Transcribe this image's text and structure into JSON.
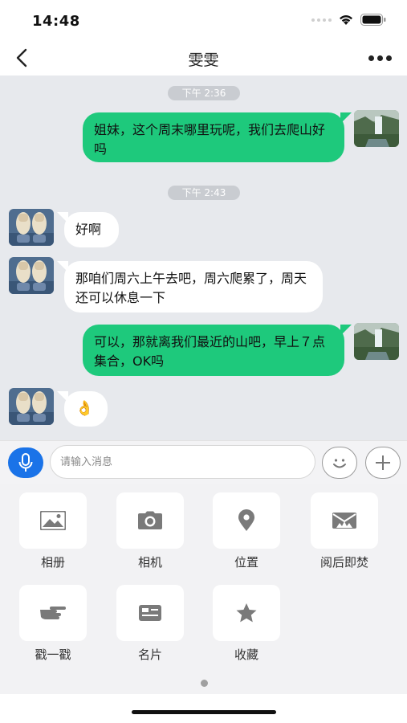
{
  "status": {
    "time": "14:48"
  },
  "nav": {
    "title": "雯雯"
  },
  "chat": {
    "time1": "下午 2:36",
    "msg1": "姐妹，这个周末哪里玩呢，我们去爬山好吗",
    "time2": "下午 2:43",
    "msg2": "好啊",
    "msg3": "那咱们周六上午去吧，周六爬累了，周天还可以休息一下",
    "msg4": "可以，那就离我们最近的山吧，早上７点集合，OK吗",
    "msg5": "👌"
  },
  "input": {
    "placeholder": "请输入消息"
  },
  "panel": {
    "items": [
      {
        "label": "相册",
        "icon": "image-icon"
      },
      {
        "label": "相机",
        "icon": "camera-icon"
      },
      {
        "label": "位置",
        "icon": "location-icon"
      },
      {
        "label": "阅后即焚",
        "icon": "burn-after-reading-icon"
      },
      {
        "label": "戳一戳",
        "icon": "poke-hand-icon"
      },
      {
        "label": "名片",
        "icon": "card-icon"
      },
      {
        "label": "收藏",
        "icon": "star-icon"
      }
    ]
  },
  "colors": {
    "accent": "#1a73e8",
    "my_bubble": "#1ec97c",
    "chat_bg": "#e7e9ed"
  }
}
